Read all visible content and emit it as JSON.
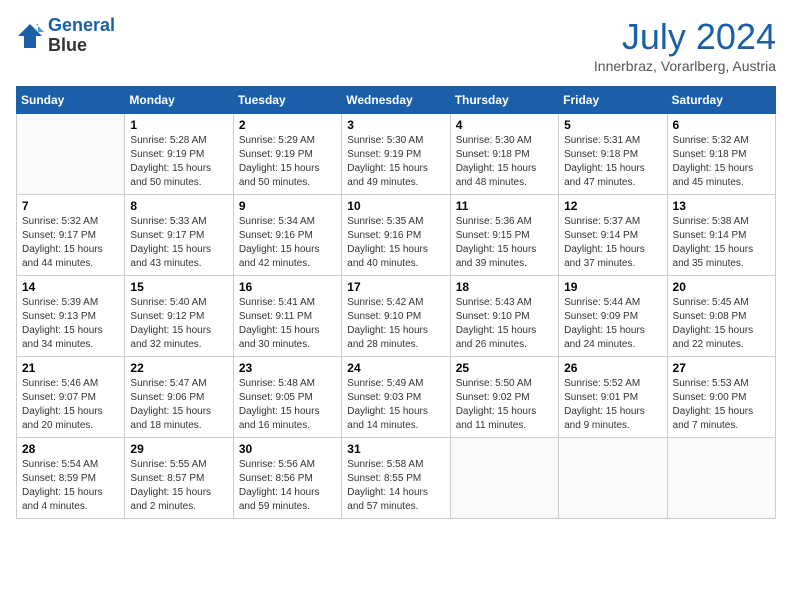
{
  "header": {
    "logo_line1": "General",
    "logo_line2": "Blue",
    "month": "July 2024",
    "location": "Innerbraz, Vorarlberg, Austria"
  },
  "weekdays": [
    "Sunday",
    "Monday",
    "Tuesday",
    "Wednesday",
    "Thursday",
    "Friday",
    "Saturday"
  ],
  "weeks": [
    [
      {
        "day": "",
        "info": ""
      },
      {
        "day": "1",
        "info": "Sunrise: 5:28 AM\nSunset: 9:19 PM\nDaylight: 15 hours\nand 50 minutes."
      },
      {
        "day": "2",
        "info": "Sunrise: 5:29 AM\nSunset: 9:19 PM\nDaylight: 15 hours\nand 50 minutes."
      },
      {
        "day": "3",
        "info": "Sunrise: 5:30 AM\nSunset: 9:19 PM\nDaylight: 15 hours\nand 49 minutes."
      },
      {
        "day": "4",
        "info": "Sunrise: 5:30 AM\nSunset: 9:18 PM\nDaylight: 15 hours\nand 48 minutes."
      },
      {
        "day": "5",
        "info": "Sunrise: 5:31 AM\nSunset: 9:18 PM\nDaylight: 15 hours\nand 47 minutes."
      },
      {
        "day": "6",
        "info": "Sunrise: 5:32 AM\nSunset: 9:18 PM\nDaylight: 15 hours\nand 45 minutes."
      }
    ],
    [
      {
        "day": "7",
        "info": "Sunrise: 5:32 AM\nSunset: 9:17 PM\nDaylight: 15 hours\nand 44 minutes."
      },
      {
        "day": "8",
        "info": "Sunrise: 5:33 AM\nSunset: 9:17 PM\nDaylight: 15 hours\nand 43 minutes."
      },
      {
        "day": "9",
        "info": "Sunrise: 5:34 AM\nSunset: 9:16 PM\nDaylight: 15 hours\nand 42 minutes."
      },
      {
        "day": "10",
        "info": "Sunrise: 5:35 AM\nSunset: 9:16 PM\nDaylight: 15 hours\nand 40 minutes."
      },
      {
        "day": "11",
        "info": "Sunrise: 5:36 AM\nSunset: 9:15 PM\nDaylight: 15 hours\nand 39 minutes."
      },
      {
        "day": "12",
        "info": "Sunrise: 5:37 AM\nSunset: 9:14 PM\nDaylight: 15 hours\nand 37 minutes."
      },
      {
        "day": "13",
        "info": "Sunrise: 5:38 AM\nSunset: 9:14 PM\nDaylight: 15 hours\nand 35 minutes."
      }
    ],
    [
      {
        "day": "14",
        "info": "Sunrise: 5:39 AM\nSunset: 9:13 PM\nDaylight: 15 hours\nand 34 minutes."
      },
      {
        "day": "15",
        "info": "Sunrise: 5:40 AM\nSunset: 9:12 PM\nDaylight: 15 hours\nand 32 minutes."
      },
      {
        "day": "16",
        "info": "Sunrise: 5:41 AM\nSunset: 9:11 PM\nDaylight: 15 hours\nand 30 minutes."
      },
      {
        "day": "17",
        "info": "Sunrise: 5:42 AM\nSunset: 9:10 PM\nDaylight: 15 hours\nand 28 minutes."
      },
      {
        "day": "18",
        "info": "Sunrise: 5:43 AM\nSunset: 9:10 PM\nDaylight: 15 hours\nand 26 minutes."
      },
      {
        "day": "19",
        "info": "Sunrise: 5:44 AM\nSunset: 9:09 PM\nDaylight: 15 hours\nand 24 minutes."
      },
      {
        "day": "20",
        "info": "Sunrise: 5:45 AM\nSunset: 9:08 PM\nDaylight: 15 hours\nand 22 minutes."
      }
    ],
    [
      {
        "day": "21",
        "info": "Sunrise: 5:46 AM\nSunset: 9:07 PM\nDaylight: 15 hours\nand 20 minutes."
      },
      {
        "day": "22",
        "info": "Sunrise: 5:47 AM\nSunset: 9:06 PM\nDaylight: 15 hours\nand 18 minutes."
      },
      {
        "day": "23",
        "info": "Sunrise: 5:48 AM\nSunset: 9:05 PM\nDaylight: 15 hours\nand 16 minutes."
      },
      {
        "day": "24",
        "info": "Sunrise: 5:49 AM\nSunset: 9:03 PM\nDaylight: 15 hours\nand 14 minutes."
      },
      {
        "day": "25",
        "info": "Sunrise: 5:50 AM\nSunset: 9:02 PM\nDaylight: 15 hours\nand 11 minutes."
      },
      {
        "day": "26",
        "info": "Sunrise: 5:52 AM\nSunset: 9:01 PM\nDaylight: 15 hours\nand 9 minutes."
      },
      {
        "day": "27",
        "info": "Sunrise: 5:53 AM\nSunset: 9:00 PM\nDaylight: 15 hours\nand 7 minutes."
      }
    ],
    [
      {
        "day": "28",
        "info": "Sunrise: 5:54 AM\nSunset: 8:59 PM\nDaylight: 15 hours\nand 4 minutes."
      },
      {
        "day": "29",
        "info": "Sunrise: 5:55 AM\nSunset: 8:57 PM\nDaylight: 15 hours\nand 2 minutes."
      },
      {
        "day": "30",
        "info": "Sunrise: 5:56 AM\nSunset: 8:56 PM\nDaylight: 14 hours\nand 59 minutes."
      },
      {
        "day": "31",
        "info": "Sunrise: 5:58 AM\nSunset: 8:55 PM\nDaylight: 14 hours\nand 57 minutes."
      },
      {
        "day": "",
        "info": ""
      },
      {
        "day": "",
        "info": ""
      },
      {
        "day": "",
        "info": ""
      }
    ]
  ]
}
